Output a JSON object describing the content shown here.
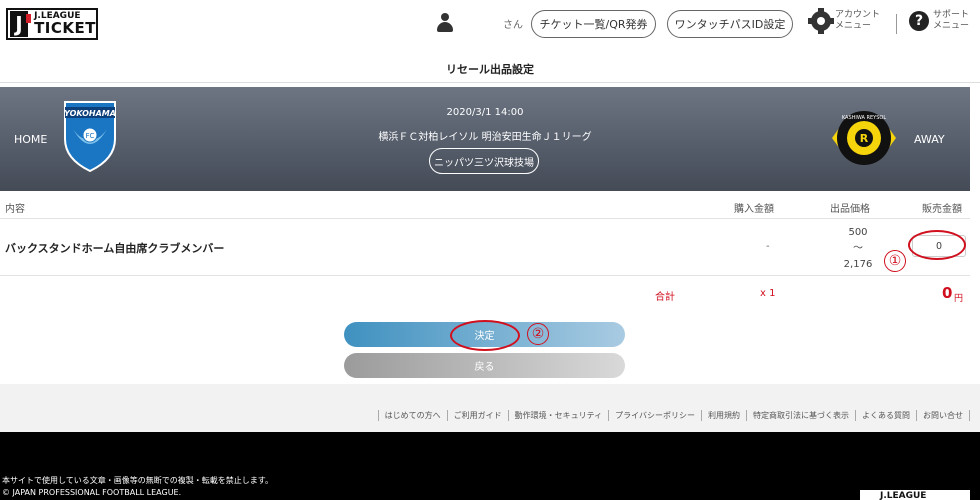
{
  "header": {
    "logo_line1": "J.LEAGUE",
    "logo_line2": "TICKET",
    "user_suffix": "さん",
    "ticket_list_button": "チケット一覧/QR発券",
    "one_touch_button": "ワンタッチパスID設定",
    "account_menu_line1": "アカウント",
    "account_menu_line2": "メニュー",
    "support_menu_line1": "サポート",
    "support_menu_line2": "メニュー"
  },
  "page_title": "リセール出品設定",
  "match": {
    "home_label": "HOME",
    "away_label": "AWAY",
    "datetime": "2020/3/1 14:00",
    "name": "横浜ＦＣ対柏レイソル 明治安田生命Ｊ１リーグ",
    "venue": "ニッパツ三ツ沢球技場",
    "home_crest_text": "YOKOHAMA",
    "home_crest_badge": "FC",
    "away_crest_text": "KASHIWA REYSOL"
  },
  "table": {
    "headers": {
      "content": "内容",
      "purchase_price": "購入金額",
      "listing_range": "出品価格",
      "sale_price": "販売金額"
    },
    "item": {
      "name": "バックスタンドホーム自由席クラブメンバー",
      "purchase_price": "-",
      "range_min": "500",
      "range_sep": "〜",
      "range_max": "2,176",
      "sale_price_value": "0"
    },
    "total": {
      "label": "合計",
      "quantity": "x 1",
      "amount": "0",
      "unit": "円"
    }
  },
  "annotations": {
    "marker1": "①",
    "marker2": "②"
  },
  "buttons": {
    "decide": "決定",
    "back": "戻る"
  },
  "footer": {
    "links": [
      "はじめての方へ",
      "ご利用ガイド",
      "動作環境・セキュリティ",
      "プライバシーポリシー",
      "利用規約",
      "特定商取引法に基づく表示",
      "よくある質問",
      "お問い合せ"
    ],
    "notice": "本サイトで使用している文章・画像等の無断での複製・転載を禁止します。",
    "copyright": "© JAPAN PROFESSIONAL FOOTBALL LEAGUE.",
    "logo_text": "J.LEAGUE"
  },
  "colors": {
    "accent_red": "#d0101e",
    "decide_button": "#3f91c0",
    "back_button": "#9b9b9b",
    "match_banner": "#5a616e"
  }
}
